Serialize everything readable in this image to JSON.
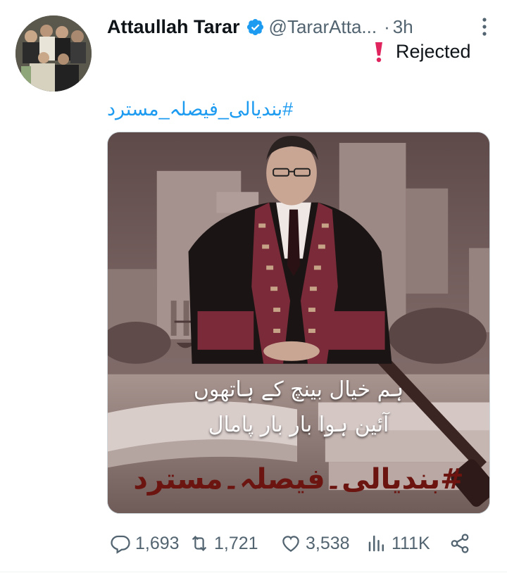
{
  "tweet": {
    "author_name": "Attaullah Tarar",
    "handle": "@TararAtta...",
    "separator": "·",
    "time": "3h",
    "text": "Rejected",
    "hashtag": "#بندیالی_فیصلہ_مسترد",
    "icons": {
      "verified": "verified-badge-icon",
      "more": "more-options-icon",
      "exclamation": "red-exclamation-icon"
    }
  },
  "media": {
    "urdu_line1": "ہم خیال بینچ کے ہاتھوں",
    "urdu_line2": "آئین ہوا بار بار پامال",
    "urdu_hashtag": "#بندیالی۔فیصلہ۔مسترد"
  },
  "actions": {
    "replies": "1,693",
    "retweets": "1,721",
    "likes": "3,538",
    "views": "111K"
  },
  "colors": {
    "accent": "#1d9bf0",
    "secondary_text": "#536471",
    "exclamation": "#e0245e"
  }
}
